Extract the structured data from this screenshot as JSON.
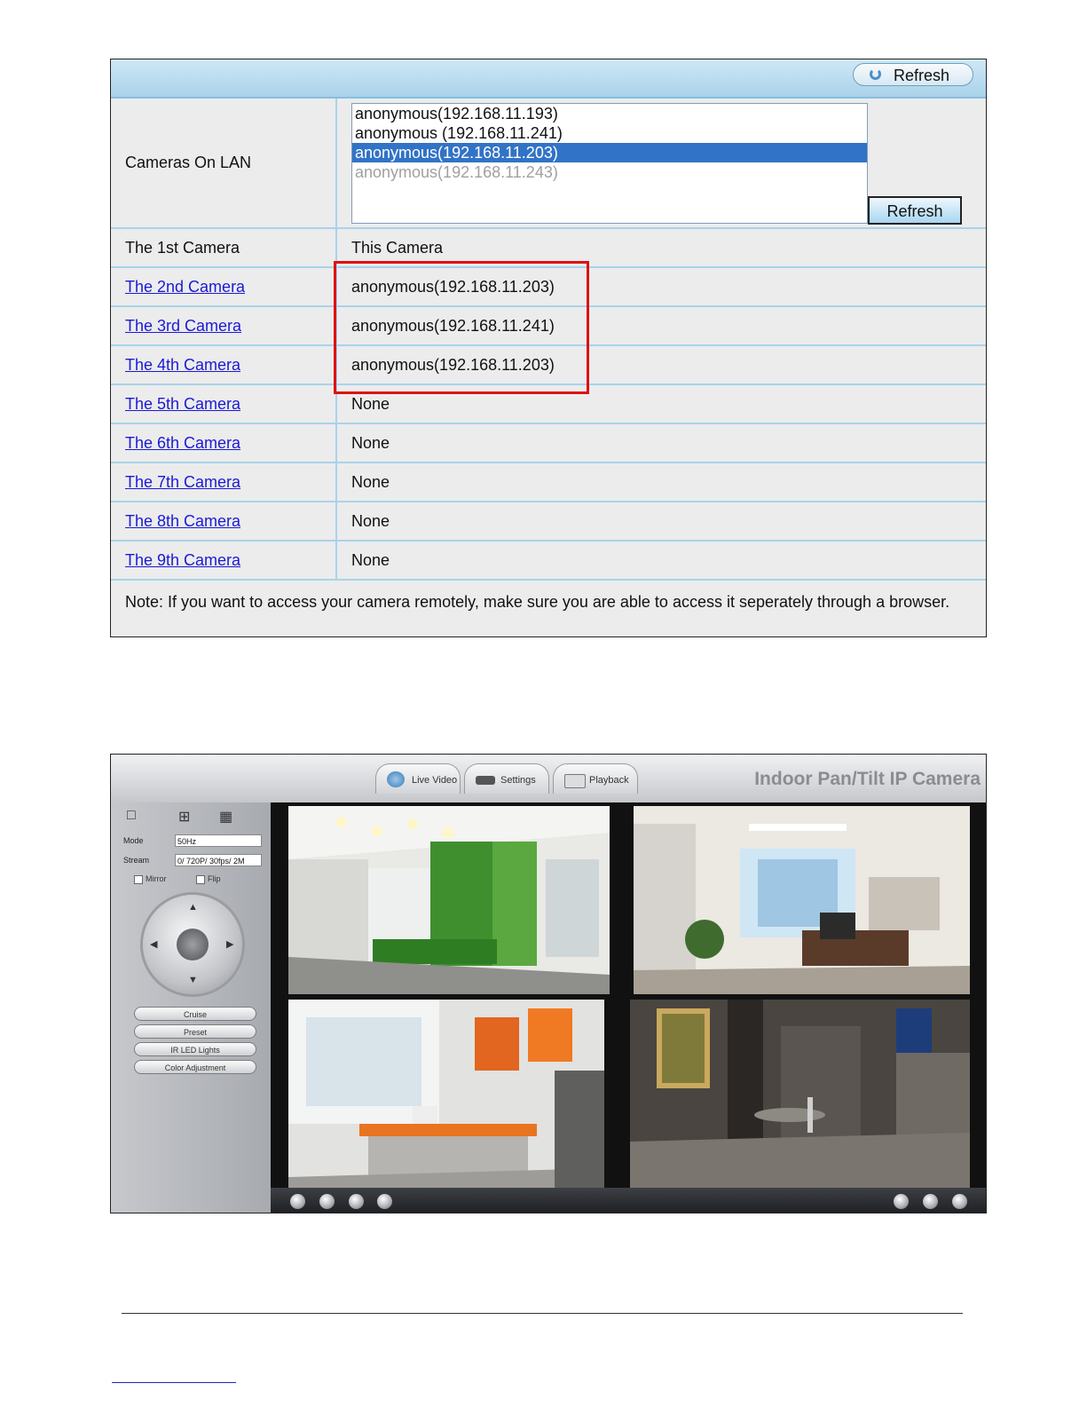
{
  "settings_panel": {
    "refresh_label": "Refresh",
    "cameras_on_lan_label": "Cameras On LAN",
    "lan_list": [
      "anonymous(192.168.11.193)",
      "anonymous (192.168.11.241)",
      "anonymous(192.168.11.203)",
      "anonymous(192.168.11.243)"
    ],
    "lan_selected_index": 2,
    "lan_refresh_label": "Refresh",
    "rows": [
      {
        "label": "The 1st Camera",
        "value": "This Camera",
        "link": false
      },
      {
        "label": "The 2nd Camera",
        "value": "anonymous(192.168.11.203)",
        "link": true
      },
      {
        "label": "The 3rd Camera",
        "value": "anonymous(192.168.11.241)",
        "link": true
      },
      {
        "label": "The 4th Camera",
        "value": "anonymous(192.168.11.203)",
        "link": true
      },
      {
        "label": "The 5th Camera",
        "value": "None",
        "link": true
      },
      {
        "label": "The 6th Camera",
        "value": "None",
        "link": true
      },
      {
        "label": "The 7th Camera",
        "value": "None",
        "link": true
      },
      {
        "label": "The 8th Camera",
        "value": "None",
        "link": true
      },
      {
        "label": "The 9th Camera",
        "value": "None",
        "link": true
      }
    ],
    "note": "Note: If you want to access your camera remotely, make sure you are able to access it seperately through a browser.",
    "highlight_color": "#e01010"
  },
  "camera_app": {
    "title": "Indoor Pan/Tilt IP Camera",
    "tabs": [
      "Live Video",
      "Settings",
      "Playback"
    ],
    "mode_label": "Mode",
    "mode_value": "50Hz",
    "stream_label": "Stream",
    "stream_value": "0/ 720P/ 30fps/ 2M",
    "mirror_label": "Mirror",
    "flip_label": "Flip",
    "buttons": [
      "Cruise",
      "Preset",
      "IR LED Lights",
      "Color Adjustment"
    ],
    "views": [
      "lobby-view",
      "office-view",
      "workspace-view",
      "hallway-view"
    ]
  }
}
